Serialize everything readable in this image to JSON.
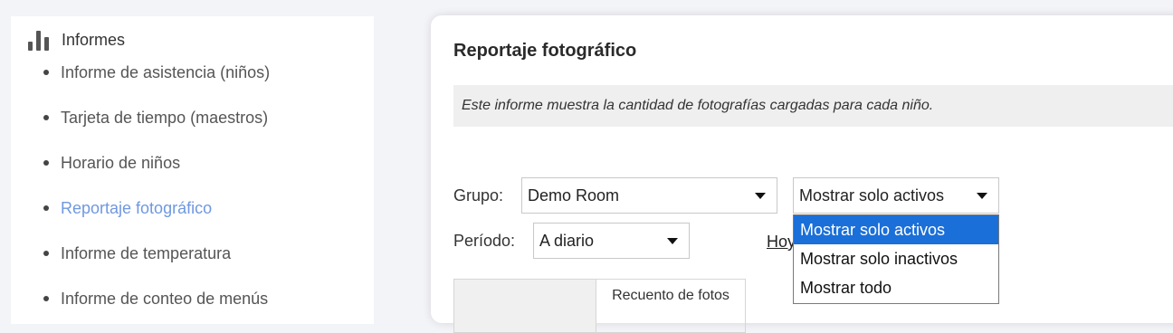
{
  "sidebar": {
    "title": "Informes",
    "items": [
      {
        "label": "Informe de asistencia (niños)"
      },
      {
        "label": "Tarjeta de tiempo (maestros)"
      },
      {
        "label": "Horario de niños"
      },
      {
        "label": "Reportaje fotográfico",
        "active": true
      },
      {
        "label": "Informe de temperatura"
      },
      {
        "label": "Informe de conteo de menús"
      }
    ]
  },
  "main": {
    "title": "Reportaje fotográfico",
    "description": "Este informe muestra la cantidad de fotografías cargadas para cada niño.",
    "group_label": "Grupo:",
    "group_value": "Demo Room",
    "filter_value": "Mostrar solo activos",
    "period_label": "Período:",
    "period_value": "A diario",
    "today_link": "Hoy",
    "table_header": "Recuento de fotos"
  },
  "dropdown": {
    "options": [
      "Mostrar solo activos",
      "Mostrar solo inactivos",
      "Mostrar todo"
    ]
  },
  "colors": {
    "active_link": "#6f98e0",
    "selected_option": "#1a6fd8"
  }
}
